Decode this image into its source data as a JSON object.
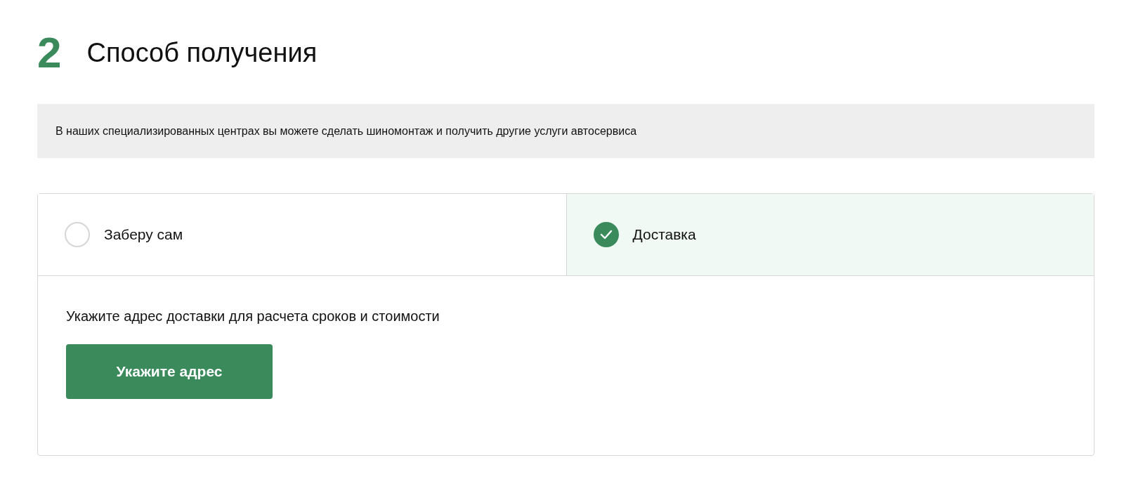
{
  "step": {
    "number": "2",
    "title": "Способ получения"
  },
  "notice": "В наших специализированных центрах вы можете сделать шиномонтаж и получить другие услуги автосервиса",
  "options": [
    {
      "label": "Заберу сам",
      "selected": false
    },
    {
      "label": "Доставка",
      "selected": true
    }
  ],
  "delivery": {
    "hint": "Укажите адрес доставки для расчета сроков и стоимости",
    "button": "Укажите адрес"
  }
}
